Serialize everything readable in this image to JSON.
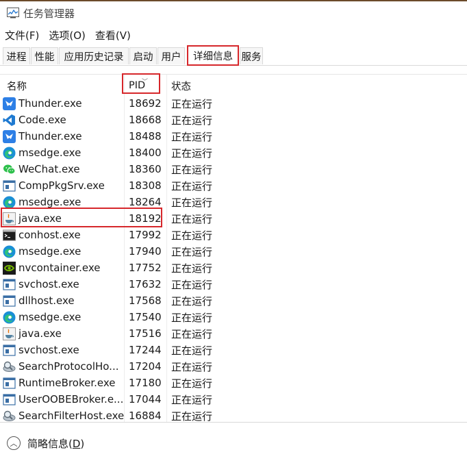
{
  "window": {
    "title": "任务管理器"
  },
  "menu": [
    "文件(F)",
    "选项(O)",
    "查看(V)"
  ],
  "tabs": [
    "进程",
    "性能",
    "应用历史记录",
    "启动",
    "用户",
    "详细信息",
    "服务"
  ],
  "active_tab": "详细信息",
  "columns": {
    "name": "名称",
    "pid": "PID",
    "status": "状态"
  },
  "rows": [
    {
      "name": "Thunder.exe",
      "pid": "18692",
      "status": "正在运行",
      "icon": "thunder-icon"
    },
    {
      "name": "Code.exe",
      "pid": "18668",
      "status": "正在运行",
      "icon": "vscode-icon"
    },
    {
      "name": "Thunder.exe",
      "pid": "18488",
      "status": "正在运行",
      "icon": "thunder-icon"
    },
    {
      "name": "msedge.exe",
      "pid": "18400",
      "status": "正在运行",
      "icon": "edge-icon"
    },
    {
      "name": "WeChat.exe",
      "pid": "18360",
      "status": "正在运行",
      "icon": "wechat-icon"
    },
    {
      "name": "CompPkgSrv.exe",
      "pid": "18308",
      "status": "正在运行",
      "icon": "window-icon"
    },
    {
      "name": "msedge.exe",
      "pid": "18264",
      "status": "正在运行",
      "icon": "edge-icon"
    },
    {
      "name": "java.exe",
      "pid": "18192",
      "status": "正在运行",
      "icon": "java-icon"
    },
    {
      "name": "conhost.exe",
      "pid": "17992",
      "status": "正在运行",
      "icon": "console-icon"
    },
    {
      "name": "msedge.exe",
      "pid": "17940",
      "status": "正在运行",
      "icon": "edge-icon"
    },
    {
      "name": "nvcontainer.exe",
      "pid": "17752",
      "status": "正在运行",
      "icon": "nvidia-icon"
    },
    {
      "name": "svchost.exe",
      "pid": "17632",
      "status": "正在运行",
      "icon": "window-icon"
    },
    {
      "name": "dllhost.exe",
      "pid": "17568",
      "status": "正在运行",
      "icon": "window-icon"
    },
    {
      "name": "msedge.exe",
      "pid": "17540",
      "status": "正在运行",
      "icon": "edge-icon"
    },
    {
      "name": "java.exe",
      "pid": "17516",
      "status": "正在运行",
      "icon": "java-icon"
    },
    {
      "name": "svchost.exe",
      "pid": "17244",
      "status": "正在运行",
      "icon": "window-icon"
    },
    {
      "name": "SearchProtocolHo...",
      "pid": "17204",
      "status": "正在运行",
      "icon": "search-indexer-icon"
    },
    {
      "name": "RuntimeBroker.exe",
      "pid": "17180",
      "status": "正在运行",
      "icon": "window-icon"
    },
    {
      "name": "UserOOBEBroker.e...",
      "pid": "17044",
      "status": "正在运行",
      "icon": "window-icon"
    },
    {
      "name": "SearchFilterHost.exe",
      "pid": "16884",
      "status": "正在运行",
      "icon": "search-indexer-icon"
    }
  ],
  "footer": {
    "label_prefix": "简略信息(",
    "label_key": "D",
    "label_suffix": ")"
  },
  "colors": {
    "highlight": "#d6262a",
    "edge": "#1a8fd6",
    "thunder": "#2d7fe6",
    "vscode": "#1f7ad1",
    "wechat": "#2dc04b",
    "nvidia": "#76b900"
  }
}
